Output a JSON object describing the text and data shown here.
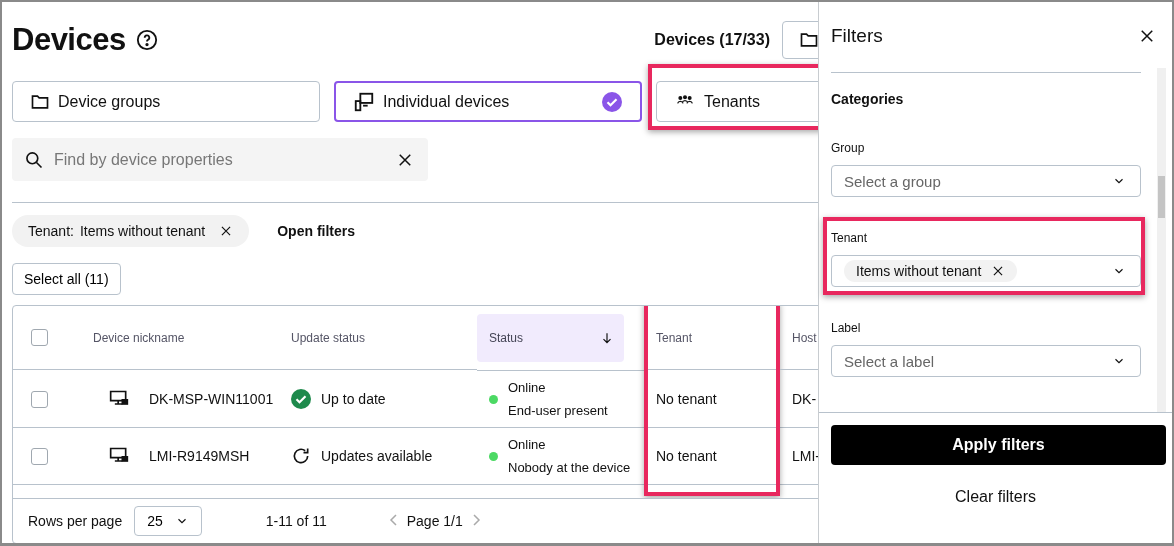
{
  "header": {
    "title": "Devices",
    "device_count": "Devices (17/33)"
  },
  "view_tabs": [
    {
      "kind": "folder",
      "label": "Device groups",
      "selected": false,
      "highlighted": false
    },
    {
      "kind": "devices",
      "label": "Individual devices",
      "selected": true,
      "highlighted": false
    },
    {
      "kind": "people",
      "label": "Tenants",
      "selected": false,
      "highlighted": true
    }
  ],
  "search": {
    "placeholder": "Find by device properties"
  },
  "active_filter": {
    "name": "Tenant:",
    "value": "Items without tenant"
  },
  "open_filters": "Open filters",
  "select_all": "Select all (11)",
  "table": {
    "header_checked": false,
    "columns": [
      {
        "label": "Device nickname",
        "sorted": false,
        "highlighted": false
      },
      {
        "label": "Update status",
        "sorted": false,
        "highlighted": false
      },
      {
        "label": "Status",
        "sorted": true,
        "highlighted": false
      },
      {
        "label": "Tenant",
        "sorted": false,
        "highlighted": true
      },
      {
        "label": "Host",
        "sorted": false,
        "highlighted": false
      }
    ],
    "rows": [
      {
        "checked": false,
        "nickname": "DK-MSP-WIN11001",
        "kind": "up_to_date",
        "update_status": "Up to date",
        "status": "Online",
        "presence": "End-user present",
        "color": "#4cd964",
        "tenant": "No tenant",
        "column_6": "DK-"
      },
      {
        "checked": false,
        "nickname": "LMI-R9149MSH",
        "kind": "available",
        "update_status": "Updates available",
        "status": "Online",
        "presence": "Nobody at the device",
        "color": "#4cd964",
        "tenant": "No tenant",
        "column_6": "LMI-"
      }
    ]
  },
  "pagination": {
    "rows_per_page_label": "Rows per page",
    "rows_per_page": "25",
    "range": "1-11 of 11",
    "page": "Page 1/1"
  },
  "filters_panel": {
    "title": "Filters",
    "section": "Categories",
    "fields": [
      {
        "label": "Group",
        "placeholder": "Select a group",
        "highlighted": false
      },
      {
        "label": "Tenant",
        "chips": [
          "Items without tenant"
        ],
        "highlighted": true
      },
      {
        "label": "Label",
        "placeholder": "Select a label",
        "highlighted": false
      }
    ],
    "apply": "Apply filters",
    "clear": "Clear filters"
  }
}
